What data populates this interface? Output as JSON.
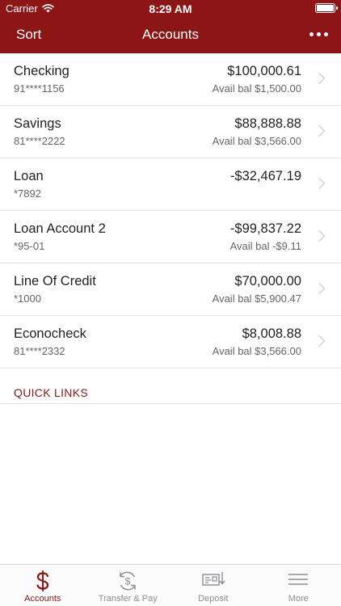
{
  "status_bar": {
    "carrier": "Carrier",
    "time": "8:29 AM"
  },
  "nav": {
    "sort_label": "Sort",
    "title": "Accounts",
    "more_icon": "ellipsis-icon"
  },
  "accounts": [
    {
      "name": "Checking",
      "number": "91****1156",
      "balance": "$100,000.61",
      "avail": "Avail bal $1,500.00"
    },
    {
      "name": "Savings",
      "number": "81****2222",
      "balance": "$88,888.88",
      "avail": "Avail bal $3,566.00"
    },
    {
      "name": "Loan",
      "number": "*7892",
      "balance": "-$32,467.19",
      "avail": ""
    },
    {
      "name": "Loan Account 2",
      "number": "*95-01",
      "balance": "-$99,837.22",
      "avail": "Avail bal -$9.11"
    },
    {
      "name": "Line Of Credit",
      "number": "*1000",
      "balance": "$70,000.00",
      "avail": "Avail bal $5,900.47"
    },
    {
      "name": "Econocheck",
      "number": "81****2332",
      "balance": "$8,008.88",
      "avail": "Avail bal $3,566.00"
    }
  ],
  "quick_links": {
    "label": "QUICK LINKS"
  },
  "tabs": [
    {
      "label": "Accounts",
      "icon": "dollar-icon",
      "active": true
    },
    {
      "label": "Transfer & Pay",
      "icon": "transfer-icon",
      "active": false
    },
    {
      "label": "Deposit",
      "icon": "check-deposit-icon",
      "active": false
    },
    {
      "label": "More",
      "icon": "menu-icon",
      "active": false
    }
  ],
  "colors": {
    "brand": "#8c1616",
    "inactive_tab": "#8e8e93",
    "divider": "#e3e3e3"
  }
}
